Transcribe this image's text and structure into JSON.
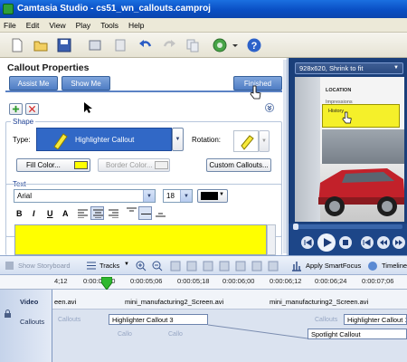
{
  "window": {
    "title": "Camtasia Studio - cs51_wn_callouts.camproj"
  },
  "menu": [
    "File",
    "Edit",
    "View",
    "Play",
    "Tools",
    "Help"
  ],
  "toolbar": {
    "icons": [
      "new-icon",
      "open-icon",
      "save-icon",
      "import-icon",
      "undo-icon",
      "redo-icon",
      "copy-icon",
      "paste-icon",
      "produce-icon",
      "help-icon"
    ]
  },
  "callout": {
    "title": "Callout Properties",
    "assist_label": "Assist Me",
    "show_label": "Show Me",
    "finished_label": "Finished",
    "shape_group": "Shape",
    "type_label": "Type:",
    "type_value": "Highlighter Callout",
    "rotation_label": "Rotation:",
    "fill_label": "Fill Color...",
    "border_label": "Border Color...",
    "custom_label": "Custom Callouts...",
    "text_group": "Text",
    "font": "Arial",
    "size": "18",
    "fill_color": "#ffff00",
    "format_buttons": [
      "B",
      "I",
      "U",
      "A"
    ]
  },
  "preview": {
    "size_label": "928x620, Shrink to fit",
    "location_label": "LOCATION",
    "menu_items": [
      "Impressions",
      "History"
    ]
  },
  "timeline": {
    "storyboard_label": "Show Storyboard",
    "tracks_label": "Tracks",
    "smartfocus_label": "Apply SmartFocus",
    "timeline_label": "Timeline",
    "ticks": [
      "4;12",
      "0:00:05;00",
      "0:00:05;06",
      "0:00:05;18",
      "0:00:06;00",
      "0:00:06;12",
      "0:00:06;24",
      "0:00:07;06"
    ],
    "video_track": "Video",
    "callouts_track": "Callouts",
    "video_clips": [
      "een.avi",
      "mini_manufacturing2_Screen.avi",
      "mini_manufacturing2_Screen.avi"
    ],
    "callout_clips": [
      "Highlighter Callout 3",
      "Highlighter Callout 1",
      "Spotlight Callout"
    ],
    "ghost_labels": [
      "Callouts",
      "Callouts",
      "Callo",
      "Callo"
    ]
  }
}
